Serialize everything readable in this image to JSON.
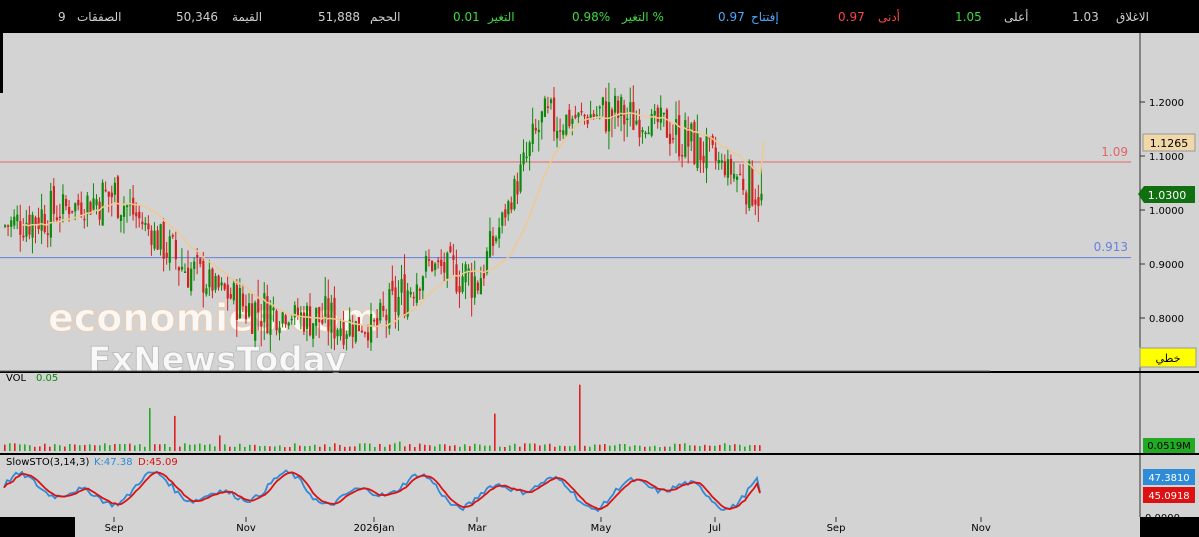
{
  "ticker_bar": {
    "close_label": "الاغلاق",
    "close_value": "1.03",
    "high_label": "أعلى",
    "high_value": "1.05",
    "low_label": "أدنى",
    "low_value": "0.97",
    "open_label": "إفتتاح",
    "open_value": "0.97",
    "change_pct_label": "التغير %",
    "change_pct_value": "0.98%",
    "change_label": "التغير",
    "change_value": "0.01",
    "volume_label": "الحجم",
    "volume_value": "51,888",
    "value_label": "القيمة",
    "value_value": "50,346",
    "trades_label": "الصفقات",
    "trades_value": "9"
  },
  "colors": {
    "panel_bg": "#d3d3d3",
    "up": "#0a8a0a",
    "down": "#d42020",
    "ma": "#f0c890",
    "resistance_line": "#e06464",
    "support_line": "#6680dd",
    "stoch_k": "#2e8bd8",
    "stoch_d": "#dd1111",
    "volume_bar": "#22aa22"
  },
  "watermark": {
    "line1": "economies.com",
    "line2": "FxNewsToday"
  },
  "price_panel": {
    "resistance_label": "1.09",
    "support_label": "0.913",
    "ma_tag": "1.1265",
    "last_price_tag": "1.0300",
    "drawing_button": "خطي"
  },
  "volume_panel": {
    "label": "VOL",
    "value": "0.05",
    "tag": "0.0519M"
  },
  "stoch_panel": {
    "label": "SlowSTO(3,14,3)",
    "k_text": "K:47.38",
    "d_text": "D:45.09",
    "k_tag": "47.3810",
    "d_tag": "45.0918",
    "zero_tag": "0.0000"
  },
  "chart_data": {
    "type": "candlestick",
    "x_ticks": [
      "Sep",
      "Nov",
      "2026Jan",
      "Mar",
      "May",
      "Jul",
      "Sep",
      "Nov"
    ],
    "y_ticks": [
      "1.2000",
      "1.1000",
      "1.0000",
      "0.9000",
      "0.8000"
    ],
    "ylim": [
      0.73,
      1.28
    ],
    "horizontal_lines": [
      {
        "name": "resistance",
        "value": 1.09
      },
      {
        "name": "support",
        "value": 0.913
      }
    ],
    "moving_average_last": 1.1265,
    "last_close": 1.03,
    "anchors": [
      {
        "month": "Aug",
        "close": 0.97
      },
      {
        "month": "Sep",
        "close": 1.03
      },
      {
        "month": "Oct",
        "close": 0.9
      },
      {
        "month": "Nov",
        "close": 0.82
      },
      {
        "month": "Dec",
        "close": 0.8
      },
      {
        "month": "2026Jan",
        "close": 0.78
      },
      {
        "month": "Feb",
        "close": 0.9
      },
      {
        "month": "Mar",
        "close": 0.87
      },
      {
        "month": "Apr",
        "close": 1.16
      },
      {
        "month": "May",
        "close": 1.18
      },
      {
        "month": "Jun",
        "close": 1.16
      },
      {
        "month": "Jul",
        "close": 1.03
      }
    ],
    "volume_last_millions": 0.0519,
    "stochastic": {
      "k": 47.38,
      "d": 45.09
    }
  }
}
